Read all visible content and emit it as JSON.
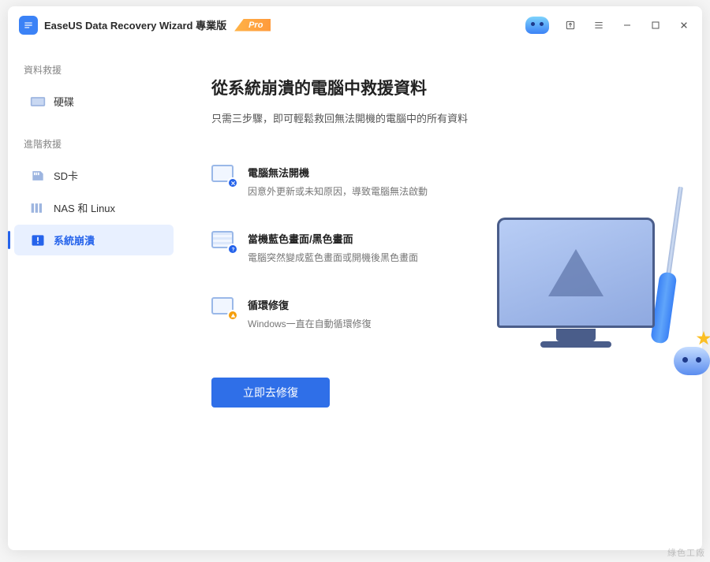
{
  "app": {
    "title": "EaseUS Data Recovery Wizard 專業版",
    "badge": "Pro"
  },
  "sidebar": {
    "section1_title": "資料救援",
    "section2_title": "進階救援",
    "items": [
      {
        "label": "硬碟"
      },
      {
        "label": "SD卡"
      },
      {
        "label": "NAS 和 Linux"
      },
      {
        "label": "系統崩潰"
      }
    ]
  },
  "main": {
    "title": "從系統崩潰的電腦中救援資料",
    "subtitle": "只需三步驟，即可輕鬆救回無法開機的電腦中的所有資料",
    "features": [
      {
        "title": "電腦無法開機",
        "desc": "因意外更新或未知原因，導致電腦無法啟動"
      },
      {
        "title": "當機藍色畫面/黑色畫面",
        "desc": "電腦突然變成藍色畫面或開機後黑色畫面"
      },
      {
        "title": "循環修復",
        "desc": "Windows一直在自動循環修復"
      }
    ],
    "cta": "立即去修復"
  },
  "watermark": "綠色工廠"
}
